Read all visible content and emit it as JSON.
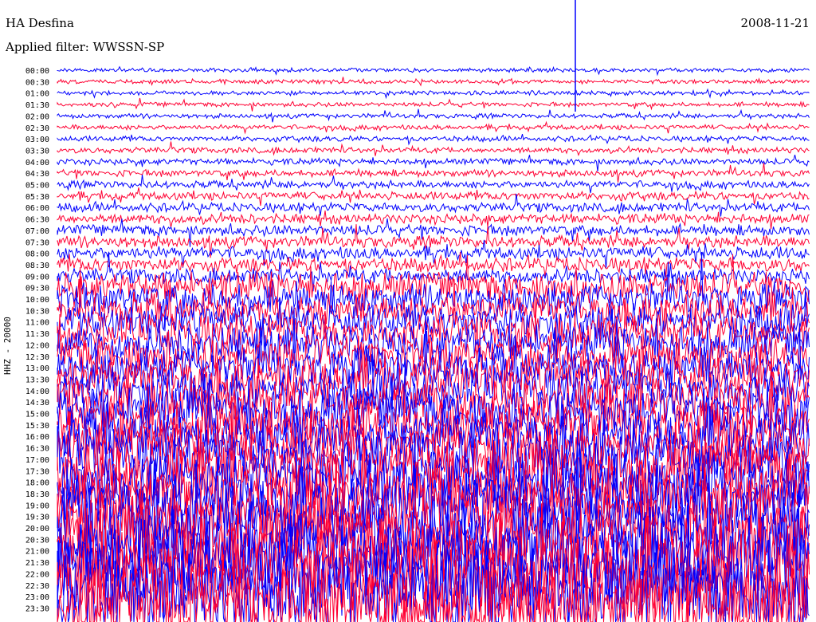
{
  "header": {
    "title": "HA Desfina",
    "date": "2008-11-21",
    "filter": "Applied filter: WWSSN-SP"
  },
  "chart_data": {
    "type": "line",
    "ylabel": "HHZ - 20000",
    "tick_labels": [
      "00:00",
      "00:30",
      "01:00",
      "01:30",
      "02:00",
      "02:30",
      "03:00",
      "03:30",
      "04:00",
      "04:30",
      "05:00",
      "05:30",
      "06:00",
      "06:30",
      "07:00",
      "07:30",
      "08:00",
      "08:30",
      "09:00",
      "09:30",
      "10:00",
      "10:30",
      "11:00",
      "11:30",
      "12:00",
      "12:30",
      "13:00",
      "13:30",
      "14:00",
      "14:30",
      "15:00",
      "15:30",
      "16:00",
      "16:30",
      "17:00",
      "17:30",
      "18:00",
      "18:30",
      "19:00",
      "19:30",
      "20:00",
      "20:30",
      "21:00",
      "21:30",
      "22:00",
      "22:30",
      "23:00",
      "23:30"
    ],
    "trace_colors": [
      "#0000ff",
      "#ff0033"
    ]
  }
}
